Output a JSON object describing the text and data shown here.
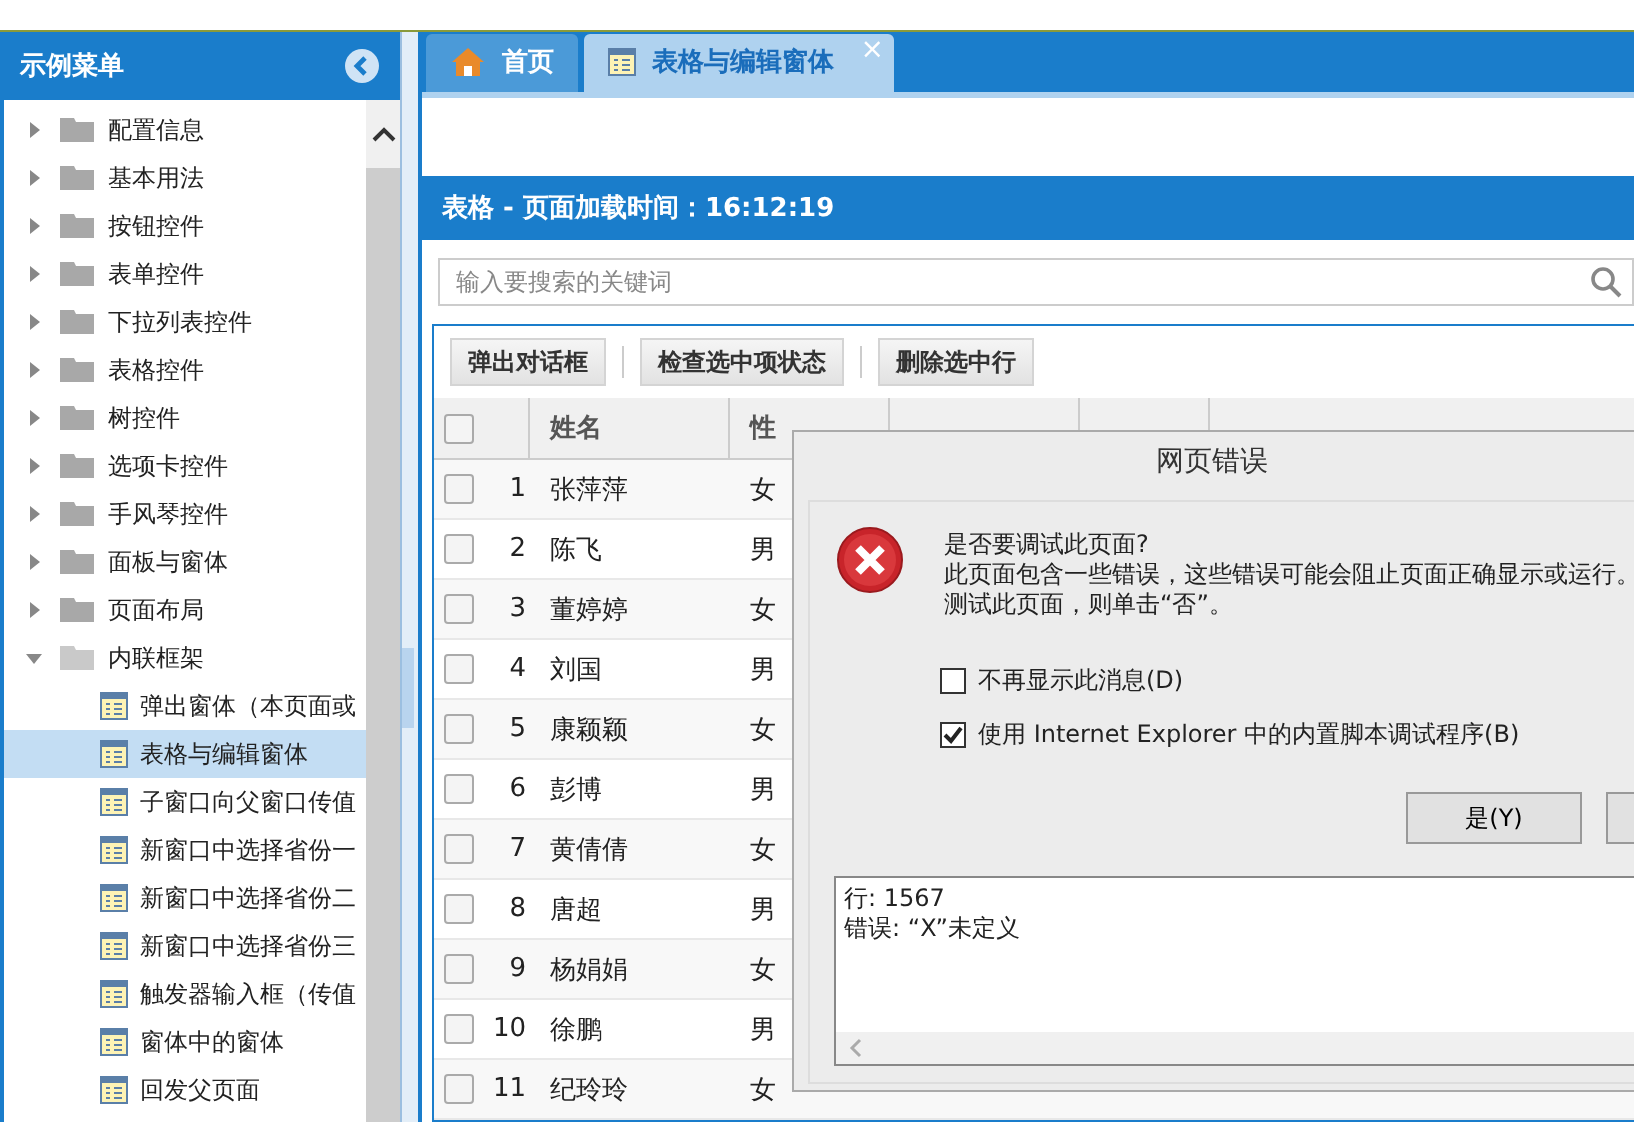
{
  "sidebar": {
    "title": "示例菜单",
    "items": [
      {
        "label": "配置信息",
        "kind": "folder",
        "expanded": false,
        "selected": false
      },
      {
        "label": "基本用法",
        "kind": "folder",
        "expanded": false,
        "selected": false
      },
      {
        "label": "按钮控件",
        "kind": "folder",
        "expanded": false,
        "selected": false
      },
      {
        "label": "表单控件",
        "kind": "folder",
        "expanded": false,
        "selected": false
      },
      {
        "label": "下拉列表控件",
        "kind": "folder",
        "expanded": false,
        "selected": false
      },
      {
        "label": "表格控件",
        "kind": "folder",
        "expanded": false,
        "selected": false
      },
      {
        "label": "树控件",
        "kind": "folder",
        "expanded": false,
        "selected": false
      },
      {
        "label": "选项卡控件",
        "kind": "folder",
        "expanded": false,
        "selected": false
      },
      {
        "label": "手风琴控件",
        "kind": "folder",
        "expanded": false,
        "selected": false
      },
      {
        "label": "面板与窗体",
        "kind": "folder",
        "expanded": false,
        "selected": false
      },
      {
        "label": "页面布局",
        "kind": "folder",
        "expanded": false,
        "selected": false
      },
      {
        "label": "内联框架",
        "kind": "folder",
        "expanded": true,
        "selected": false,
        "children": [
          {
            "label": "弹出窗体（本页面或",
            "kind": "page",
            "selected": false
          },
          {
            "label": "表格与编辑窗体",
            "kind": "page",
            "selected": true
          },
          {
            "label": "子窗口向父窗口传值",
            "kind": "page",
            "selected": false
          },
          {
            "label": "新窗口中选择省份一",
            "kind": "page",
            "selected": false
          },
          {
            "label": "新窗口中选择省份二",
            "kind": "page",
            "selected": false
          },
          {
            "label": "新窗口中选择省份三",
            "kind": "page",
            "selected": false
          },
          {
            "label": "触发器输入框（传值",
            "kind": "page",
            "selected": false
          },
          {
            "label": "窗体中的窗体",
            "kind": "page",
            "selected": false
          },
          {
            "label": "回发父页面",
            "kind": "page",
            "selected": false
          }
        ]
      }
    ]
  },
  "tabs": [
    {
      "label": "首页",
      "kind": "home",
      "selected": false
    },
    {
      "label": "表格与编辑窗体",
      "kind": "page",
      "selected": true,
      "close": "×"
    }
  ],
  "panel": {
    "title": "表格 - 页面加载时间：16:12:19",
    "search": {
      "placeholder": "输入要搜索的关键词"
    },
    "toolbar": [
      "弹出对话框",
      "检查选中项状态",
      "删除选中行"
    ],
    "table": {
      "columns": [
        "姓名",
        "性"
      ],
      "header_checked": false,
      "rows": [
        {
          "checked": false,
          "number": "1",
          "name": "张萍萍",
          "gender": "女"
        },
        {
          "checked": false,
          "number": "2",
          "name": "陈飞",
          "gender": "男"
        },
        {
          "checked": false,
          "number": "3",
          "name": "董婷婷",
          "gender": "女"
        },
        {
          "checked": false,
          "number": "4",
          "name": "刘国",
          "gender": "男"
        },
        {
          "checked": false,
          "number": "5",
          "name": "康颖颖",
          "gender": "女"
        },
        {
          "checked": false,
          "number": "6",
          "name": "彭博",
          "gender": "男"
        },
        {
          "checked": false,
          "number": "7",
          "name": "黄倩倩",
          "gender": "女"
        },
        {
          "checked": false,
          "number": "8",
          "name": "唐超",
          "gender": "男"
        },
        {
          "checked": false,
          "number": "9",
          "name": "杨娟娟",
          "gender": "女"
        },
        {
          "checked": false,
          "number": "10",
          "name": "徐鹏",
          "gender": "男"
        },
        {
          "checked": false,
          "number": "11",
          "name": "纪玲玲",
          "gender": "女"
        }
      ]
    }
  },
  "dialog": {
    "title": "网页错误",
    "question": "是否要调试此页面?",
    "message_lines": [
      "此页面包含一些错误，这些错误可能会阻止页面正确显示或运行。",
      "测试此页面，则单击“否”。"
    ],
    "options": [
      {
        "label": "不再显示此消息(D)",
        "checked": false
      },
      {
        "label": "使用 Internet Explorer 中的内置脚本调试程序(B)",
        "checked": true
      }
    ],
    "buttons": [
      "是(Y)"
    ],
    "details": [
      "行: 1567",
      "错误: “X”未定义"
    ]
  }
}
